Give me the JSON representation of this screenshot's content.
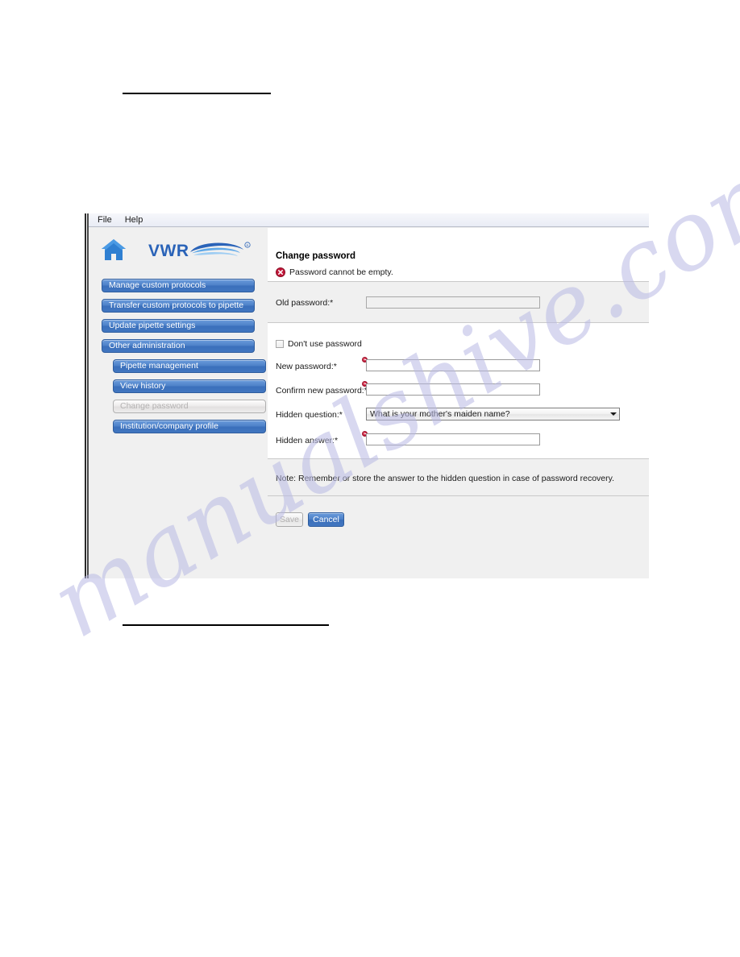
{
  "window": {
    "menubar": [
      "File",
      "Help"
    ]
  },
  "sidebar": {
    "home_icon": "home-icon",
    "logo_text": "VWR",
    "nav": [
      {
        "label": "Manage custom protocols",
        "level": "primary",
        "state": "enabled"
      },
      {
        "label": "Transfer custom protocols to pipette",
        "level": "primary",
        "state": "enabled"
      },
      {
        "label": "Update pipette settings",
        "level": "primary",
        "state": "enabled"
      },
      {
        "label": "Other administration",
        "level": "primary",
        "state": "enabled"
      },
      {
        "label": "Pipette management",
        "level": "sub",
        "state": "enabled"
      },
      {
        "label": "View history",
        "level": "sub",
        "state": "enabled"
      },
      {
        "label": "Change password",
        "level": "sub",
        "state": "disabled"
      },
      {
        "label": "Institution/company profile",
        "level": "sub",
        "state": "enabled"
      }
    ]
  },
  "content": {
    "title": "Change password",
    "error_icon": "error-circle-icon",
    "error_message": "Password cannot be empty.",
    "fields": {
      "old_password": {
        "label": "Old password:*",
        "value": "",
        "state": "disabled",
        "has_error": false
      },
      "dont_use_password": {
        "label": "Don't use password",
        "checked": false
      },
      "new_password": {
        "label": "New password:*",
        "value": "",
        "state": "enabled",
        "has_error": true
      },
      "confirm_new_password": {
        "label": "Confirm new password:*",
        "value": "",
        "state": "enabled",
        "has_error": true
      },
      "hidden_question": {
        "label": "Hidden question:*",
        "value": "What is your mother's maiden name?",
        "state": "enabled",
        "has_error": false
      },
      "hidden_answer": {
        "label": "Hidden answer:*",
        "value": "",
        "state": "enabled",
        "has_error": true
      }
    },
    "note": "Note: Remember or store the answer to the hidden question in case of password recovery.",
    "buttons": {
      "save": {
        "label": "Save",
        "state": "disabled"
      },
      "cancel": {
        "label": "Cancel",
        "state": "enabled"
      }
    }
  },
  "page": {
    "watermark": "manualshive.com"
  },
  "colors": {
    "nav_blue": "#4276c0",
    "error_red": "#c2183a",
    "logo_blue": "#2a63b8"
  }
}
